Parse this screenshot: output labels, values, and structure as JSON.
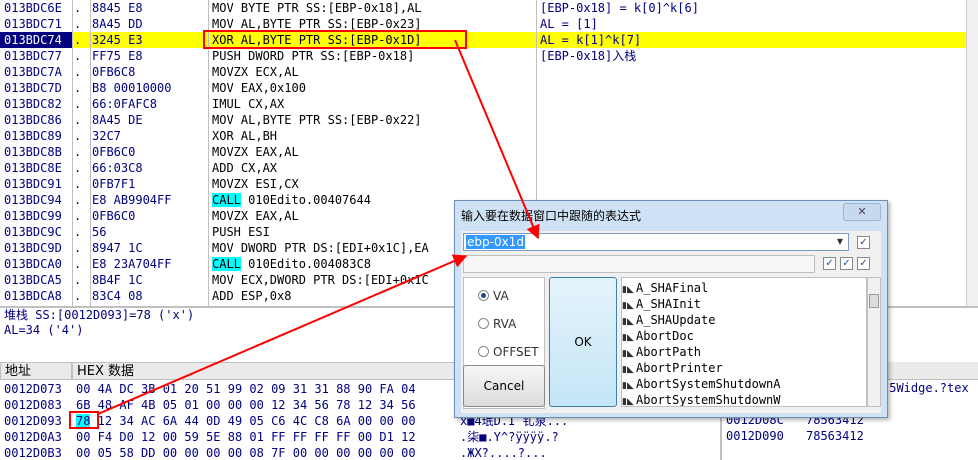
{
  "disasm": {
    "rows": [
      {
        "addr": "013BDC6E",
        "mark": ".",
        "hex": "8845 E8",
        "ins": "MOV BYTE PTR SS:[EBP-0x18],AL",
        "com": "[EBP-0x18] = k[0]^k[6]"
      },
      {
        "addr": "013BDC71",
        "mark": ".",
        "hex": "8A45 DD",
        "ins": "MOV AL,BYTE PTR SS:[EBP-0x23]",
        "com": "AL = [1]"
      },
      {
        "addr": "013BDC74",
        "mark": ".",
        "hex": "3245 E3",
        "ins": "XOR AL,BYTE PTR SS:[EBP-0x1D]",
        "com": "AL = k[1]^k[7]"
      },
      {
        "addr": "013BDC77",
        "mark": ".",
        "hex": "FF75 E8",
        "ins": "PUSH DWORD PTR SS:[EBP-0x18]",
        "com": "[EBP-0x18]入栈"
      },
      {
        "addr": "013BDC7A",
        "mark": ".",
        "hex": "0FB6C8",
        "ins": "MOVZX ECX,AL",
        "com": ""
      },
      {
        "addr": "013BDC7D",
        "mark": ".",
        "hex": "B8 00010000",
        "ins": "MOV EAX,0x100",
        "com": ""
      },
      {
        "addr": "013BDC82",
        "mark": ".",
        "hex": "66:0FAFC8",
        "ins": "IMUL CX,AX",
        "com": ""
      },
      {
        "addr": "013BDC86",
        "mark": ".",
        "hex": "8A45 DE",
        "ins": "MOV AL,BYTE PTR SS:[EBP-0x22]",
        "com": ""
      },
      {
        "addr": "013BDC89",
        "mark": ".",
        "hex": "32C7",
        "ins": "XOR AL,BH",
        "com": ""
      },
      {
        "addr": "013BDC8B",
        "mark": ".",
        "hex": "0FB6C0",
        "ins": "MOVZX EAX,AL",
        "com": ""
      },
      {
        "addr": "013BDC8E",
        "mark": ".",
        "hex": "66:03C8",
        "ins": "ADD CX,AX",
        "com": ""
      },
      {
        "addr": "013BDC91",
        "mark": ".",
        "hex": "0FB7F1",
        "ins": "MOVZX ESI,CX",
        "com": ""
      },
      {
        "addr": "013BDC94",
        "mark": ".",
        "hex": "E8 AB9904FF",
        "ins": "CALL",
        "arg": " 010Edito.00407644",
        "com": ""
      },
      {
        "addr": "013BDC99",
        "mark": ".",
        "hex": "0FB6C0",
        "ins": "MOVZX EAX,AL",
        "com": ""
      },
      {
        "addr": "013BDC9C",
        "mark": ".",
        "hex": "56",
        "ins": "PUSH ESI",
        "com": ""
      },
      {
        "addr": "013BDC9D",
        "mark": ".",
        "hex": "8947 1C",
        "ins": "MOV DWORD PTR DS:[EDI+0x1C],EA",
        "com": ""
      },
      {
        "addr": "013BDCA0",
        "mark": ".",
        "hex": "E8 23A704FF",
        "ins": "CALL",
        "arg": " 010Edito.004083C8",
        "com": ""
      },
      {
        "addr": "013BDCA5",
        "mark": ".",
        "hex": "8B4F 1C",
        "ins": "MOV ECX,DWORD PTR DS:[EDI+0x1C",
        "com": ""
      },
      {
        "addr": "013BDCA8",
        "mark": ".",
        "hex": "83C4 08",
        "ins": "ADD ESP,0x8",
        "com": ""
      }
    ]
  },
  "info": {
    "line1": "堆栈 SS:[0012D093]=78 ('x')",
    "line2": "AL=34 ('4')"
  },
  "dump": {
    "header_addr": "地址",
    "header_hex": "HEX 数据",
    "rows": [
      {
        "a": "0012D073",
        "h": "00 4A DC 3B 01 20 51 99 02 09 31 31 88 90 FA 04",
        "t": ""
      },
      {
        "a": "0012D083",
        "h": "6B 48 AF 4B 05 01 00 00 00 12 34 56 78 12 34 56",
        "t": ""
      },
      {
        "a": "0012D093",
        "h": "78 12 34 AC 6A 44 0D 49 05 C6 4C C8 6A 00 00 00",
        "t": "x■4珉D.I 钆泉..."
      },
      {
        "a": "0012D0A3",
        "h": "00 F4 D0 12 00 59 5E 88 01 FF FF FF FF 00 D1 12",
        "t": ".柒■.Y^?ÿÿÿÿ.?"
      },
      {
        "a": "0012D0B3",
        "h": "00 05 58 DD 00 00 00 00 08 7F 00 00 00 00 00 00",
        "t": ".ЖX?....?..."
      }
    ]
  },
  "stack": {
    "tail": "t5Widge.?tex",
    "rows": [
      {
        "a": "",
        "v": "00000001"
      },
      {
        "a": "0012D08C",
        "v": "78563412"
      },
      {
        "a": "0012D090",
        "v": "78563412"
      }
    ]
  },
  "dialog": {
    "title": "输入要在数据窗口中跟随的表达式",
    "close": "✕",
    "expression": "ebp-0x1d",
    "radios": [
      "VA",
      "RVA",
      "OFFSET"
    ],
    "selected_radio": "VA",
    "ok": "OK",
    "cancel": "Cancel",
    "symbols": [
      "A_SHAFinal",
      "A_SHAInit",
      "A_SHAUpdate",
      "AbortDoc",
      "AbortPath",
      "AbortPrinter",
      "AbortSystemShutdownA",
      "AbortSystemShutdownW",
      "AccessCheck"
    ]
  },
  "colors": {
    "selection": "#ffff00",
    "annotation": "#ff0000",
    "call_bg": "#00ffff"
  }
}
